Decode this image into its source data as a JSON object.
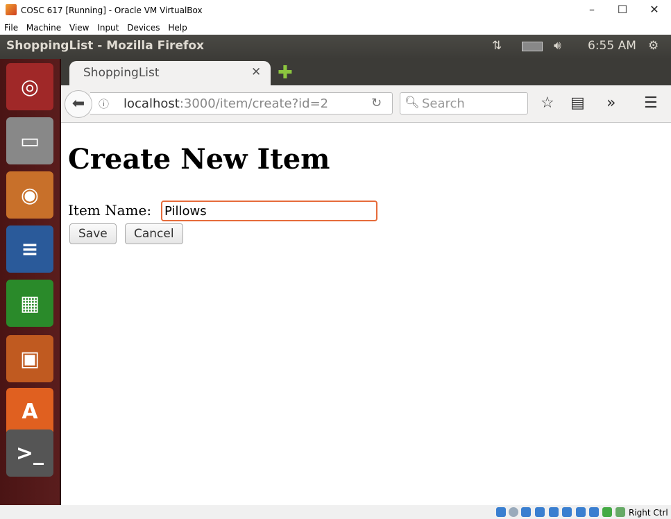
{
  "window": {
    "title": "COSC 617 [Running] - Oracle VM VirtualBox",
    "menu": [
      "File",
      "Machine",
      "View",
      "Input",
      "Devices",
      "Help"
    ]
  },
  "panel": {
    "window_title": "ShoppingList - Mozilla Firefox",
    "clock": "6:55 AM"
  },
  "launcher": {
    "items": [
      "ubuntu-dash",
      "files",
      "firefox",
      "writer",
      "calc",
      "impress",
      "software-center",
      "system-settings",
      "terminal"
    ]
  },
  "browser": {
    "tab_title": "ShoppingList",
    "url_host": "localhost",
    "url_rest": ":3000/item/create?id=2",
    "search_placeholder": "Search"
  },
  "page": {
    "heading": "Create New Item",
    "item_label": "Item Name:",
    "item_value": "Pillows",
    "save": "Save",
    "cancel": "Cancel"
  },
  "statusbar": {
    "host_key": "Right Ctrl"
  }
}
